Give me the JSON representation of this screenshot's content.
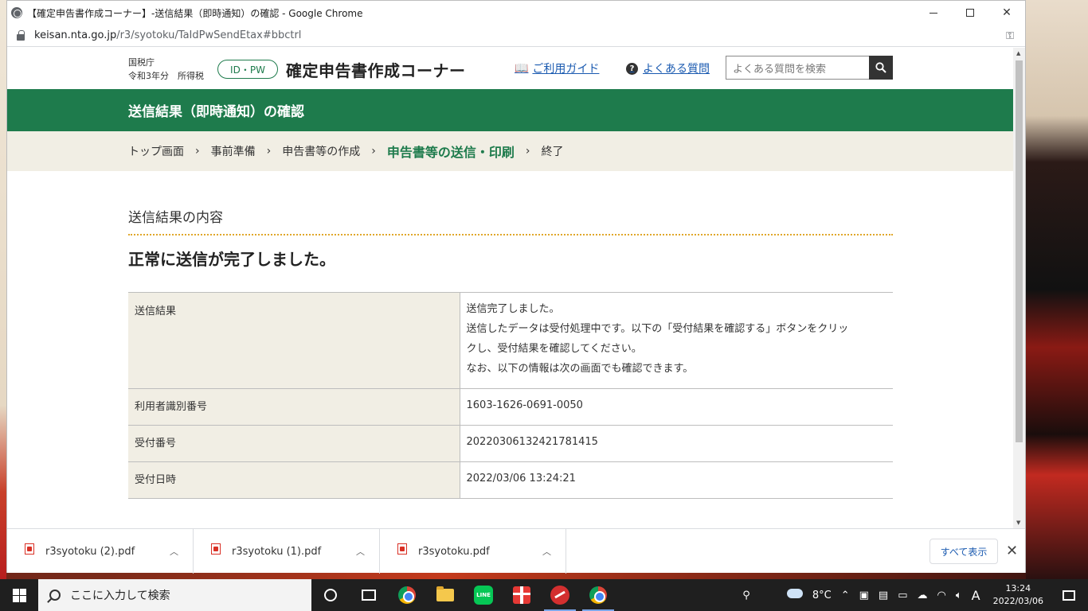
{
  "window": {
    "title": "【確定申告書作成コーナー】-送信結果（即時通知）の確認 - Google Chrome",
    "url_domain": "keisan.nta.go.jp",
    "url_path": "/r3/syotoku/TaIdPwSendEtax#bbctrl"
  },
  "header": {
    "agency": "国税庁",
    "year_tax": "令和3年分　所得税",
    "id_pill": "ID・PW",
    "site_title": "確定申告書作成コーナー",
    "guide_link": "ご利用ガイド",
    "faq_link": "よくある質問",
    "search_placeholder": "よくある質問を検索"
  },
  "page_heading": "送信結果（即時通知）の確認",
  "breadcrumb": [
    {
      "label": "トップ画面",
      "active": false
    },
    {
      "label": "事前準備",
      "active": false
    },
    {
      "label": "申告書等の作成",
      "active": false
    },
    {
      "label": "申告書等の送信・印刷",
      "active": true
    },
    {
      "label": "終了",
      "active": false
    }
  ],
  "section_title": "送信結果の内容",
  "result_heading": "正常に送信が完了しました。",
  "result_table": [
    {
      "label": "送信結果",
      "lines": [
        "送信完了しました。",
        "送信したデータは受付処理中です。以下の「受付結果を確認する」ボタンをクリッ",
        "クし、受付結果を確認してください。",
        "なお、以下の情報は次の画面でも確認できます。"
      ]
    },
    {
      "label": "利用者識別番号",
      "lines": [
        "1603-1626-0691-0050"
      ]
    },
    {
      "label": "受付番号",
      "lines": [
        "20220306132421781415"
      ]
    },
    {
      "label": "受付日時",
      "lines": [
        "2022/03/06 13:24:21"
      ]
    }
  ],
  "downloads": [
    {
      "name": "r3syotoku (2).pdf"
    },
    {
      "name": "r3syotoku (1).pdf"
    },
    {
      "name": "r3syotoku.pdf"
    }
  ],
  "show_all_label": "すべて表示",
  "taskbar": {
    "search_placeholder": "ここに入力して検索",
    "weather": "8°C",
    "ime": "A",
    "time": "13:24",
    "date": "2022/03/06"
  }
}
